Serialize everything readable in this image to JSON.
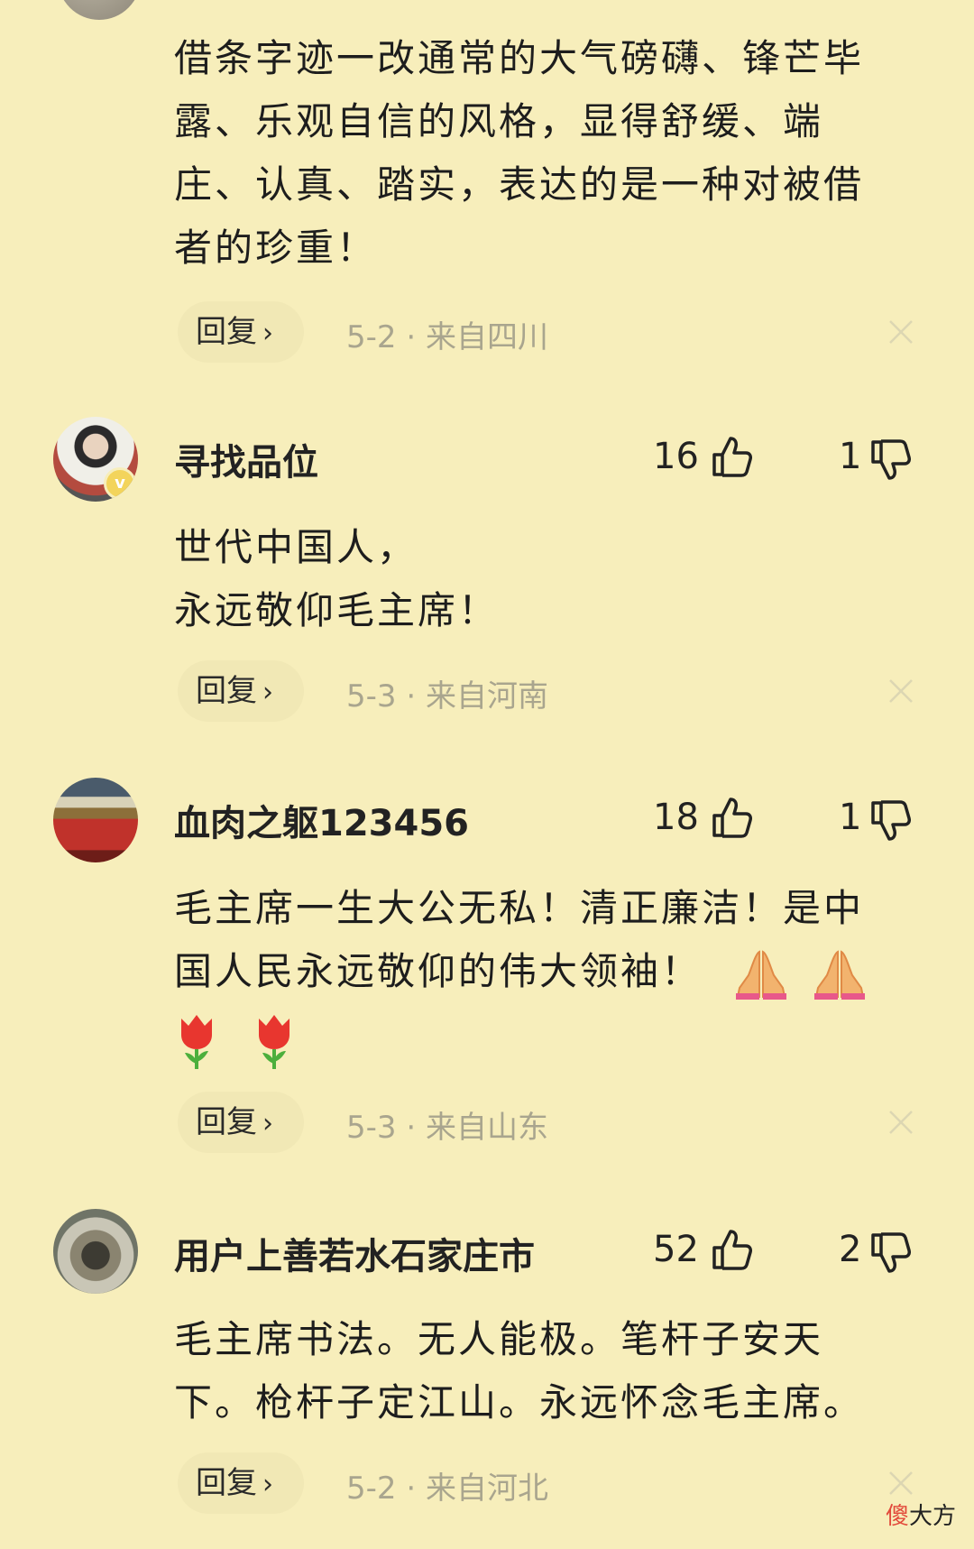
{
  "comments": [
    {
      "username": "",
      "lines": [
        "借条字迹一改通常的大气磅礴、锋芒毕",
        "露、乐观自信的风格，显得舒缓、端",
        "庄、认真、踏实，表达的是一种对被借",
        "者的珍重！"
      ],
      "reply_label": "回复",
      "meta": "5-2 · 来自四川"
    },
    {
      "username": "寻找品位",
      "likes": "16",
      "dislikes": "1",
      "lines": [
        "世代中国人，",
        "永远敬仰毛主席！"
      ],
      "reply_label": "回复",
      "meta": "5-3 · 来自河南"
    },
    {
      "username": "血肉之躯123456",
      "likes": "18",
      "dislikes": "1",
      "lines": [
        "毛主席一生大公无私！清正廉洁！是中",
        "国人民永远敬仰的伟大领袖！"
      ],
      "emojis": [
        "folded-hands",
        "folded-hands",
        "tulip",
        "tulip"
      ],
      "reply_label": "回复",
      "meta": "5-3 · 来自山东"
    },
    {
      "username": "用户上善若水石家庄市",
      "likes": "52",
      "dislikes": "2",
      "lines": [
        "毛主席书法。无人能极。笔杆子安天",
        "下。枪杆子定江山。永远怀念毛主席。"
      ],
      "reply_label": "回复",
      "meta": "5-2 · 来自河北"
    }
  ],
  "icons": {
    "like": "thumbs-up-icon",
    "dislike": "thumbs-down-icon",
    "close": "close-icon",
    "reply_chevron": "chevron-right-icon"
  },
  "watermark": {
    "part1": "傻",
    "part2": "大方"
  },
  "colors": {
    "background": "#f7eebb",
    "meta_text": "#a9a58e",
    "reply_bg": "#f1e8b5"
  }
}
